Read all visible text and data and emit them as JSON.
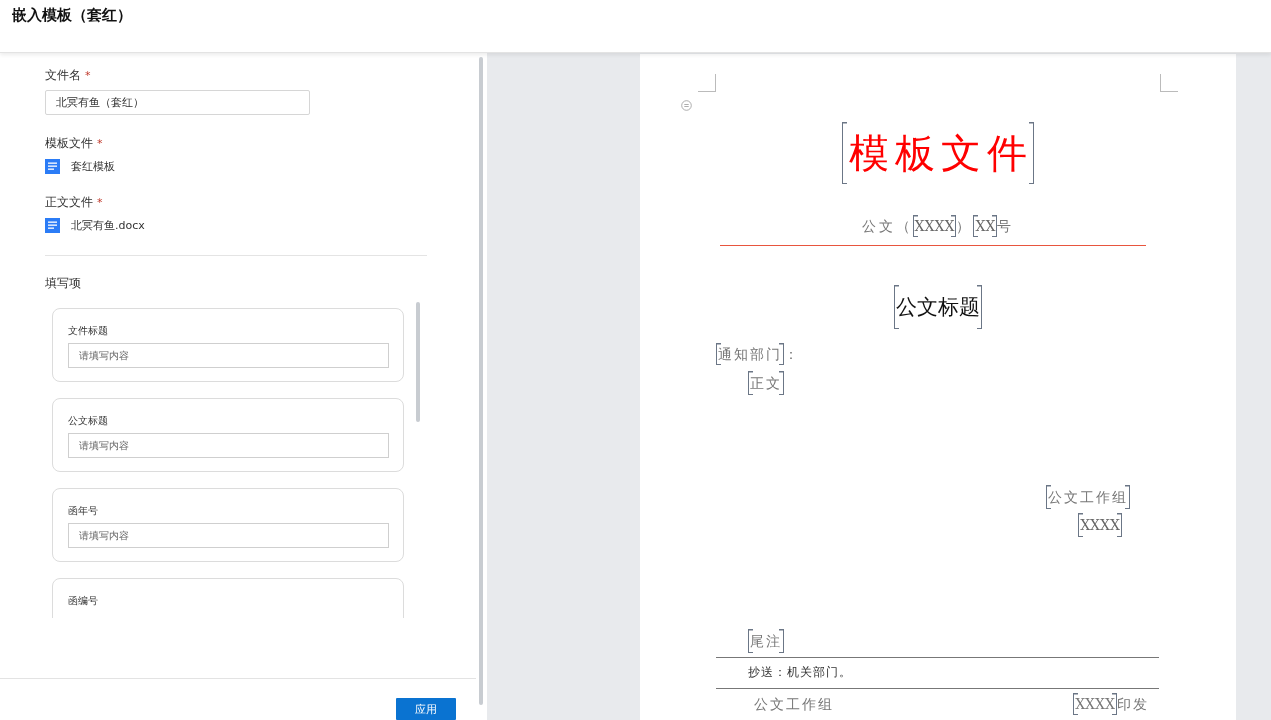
{
  "dialog": {
    "title": "嵌入模板（套红）"
  },
  "form": {
    "file_name": {
      "label": "文件名",
      "required_mark": "*",
      "value": "北冥有鱼（套红）"
    },
    "template_file": {
      "label": "模板文件",
      "required_mark": "*",
      "file": "套红模板"
    },
    "body_file": {
      "label": "正文文件",
      "required_mark": "*",
      "file": "北冥有鱼.docx"
    },
    "fill_section": {
      "title": "填写项",
      "items": [
        {
          "label": "文件标题",
          "placeholder": "请填写内容"
        },
        {
          "label": "公文标题",
          "placeholder": "请填写内容"
        },
        {
          "label": "函年号",
          "placeholder": "请填写内容"
        },
        {
          "label": "函编号"
        }
      ]
    }
  },
  "apply_button": "应用",
  "document": {
    "header": [
      {
        "text": "模板文件",
        "field": true
      }
    ],
    "doc_number": [
      {
        "text": "公文（",
        "field": false
      },
      {
        "text": "XXXX",
        "field": true
      },
      {
        "text": "）",
        "field": false
      },
      {
        "text": "XX",
        "field": true
      },
      {
        "text": "号",
        "field": false
      }
    ],
    "title": [
      {
        "text": "公文标题",
        "field": true
      }
    ],
    "recipient": [
      {
        "text": "通知部门",
        "field": true
      },
      {
        "text": "：",
        "field": false
      }
    ],
    "body": [
      {
        "text": "正文",
        "field": true
      }
    ],
    "signature": [
      {
        "text": "公文工作组",
        "field": true
      }
    ],
    "date": [
      {
        "text": "XXXX",
        "field": true
      }
    ],
    "endnote": [
      {
        "text": "尾注",
        "field": true
      }
    ],
    "cc": [
      {
        "text": "抄送：机关部门。",
        "field": false
      }
    ],
    "footer_org": [
      {
        "text": "公文工作组",
        "field": false
      }
    ],
    "footer_issue": [
      {
        "text": "XXXX",
        "field": true
      },
      {
        "text": "印发",
        "field": false
      }
    ]
  }
}
